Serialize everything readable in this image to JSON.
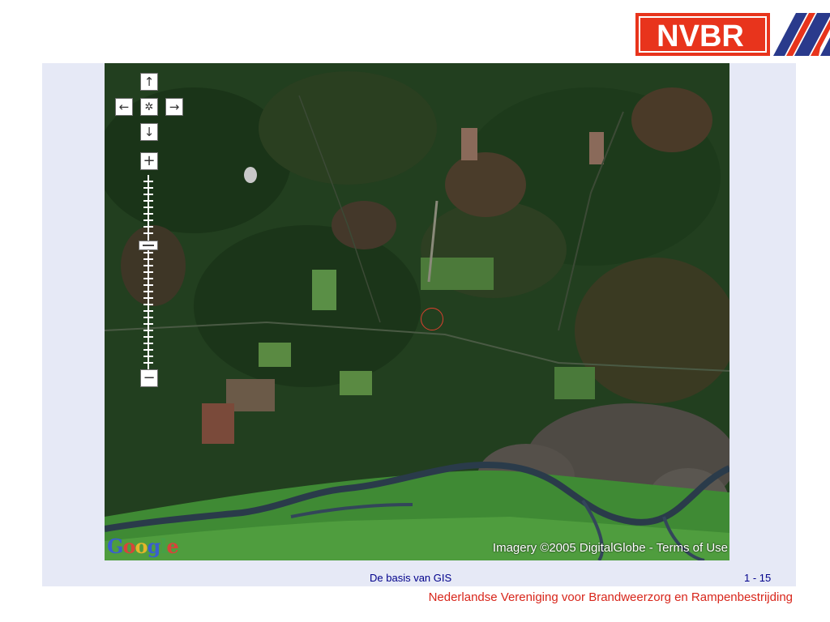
{
  "logo": {
    "text": "NVBR",
    "bg_color": "#e8341c",
    "stripe_color": "#2a3a8c"
  },
  "map": {
    "controls": {
      "pan_up_icon": "↑",
      "pan_left_icon": "←",
      "pan_center_icon": "✲",
      "pan_right_icon": "→",
      "pan_down_icon": "↓",
      "zoom_in_icon": "+",
      "zoom_out_icon": "−"
    },
    "brand_letters": [
      "G",
      "o",
      "o",
      "g",
      "l",
      "e"
    ],
    "imagery_credit": "Imagery ©2005 DigitalGlobe",
    "separator": " - ",
    "terms_link": "Terms of Use",
    "marker_color": "#d8402f"
  },
  "footer": {
    "title": "De basis van GIS",
    "page": "1 - 15",
    "organization": "Nederlandse Vereniging voor Brandweerzorg en Rampenbestrijding"
  }
}
